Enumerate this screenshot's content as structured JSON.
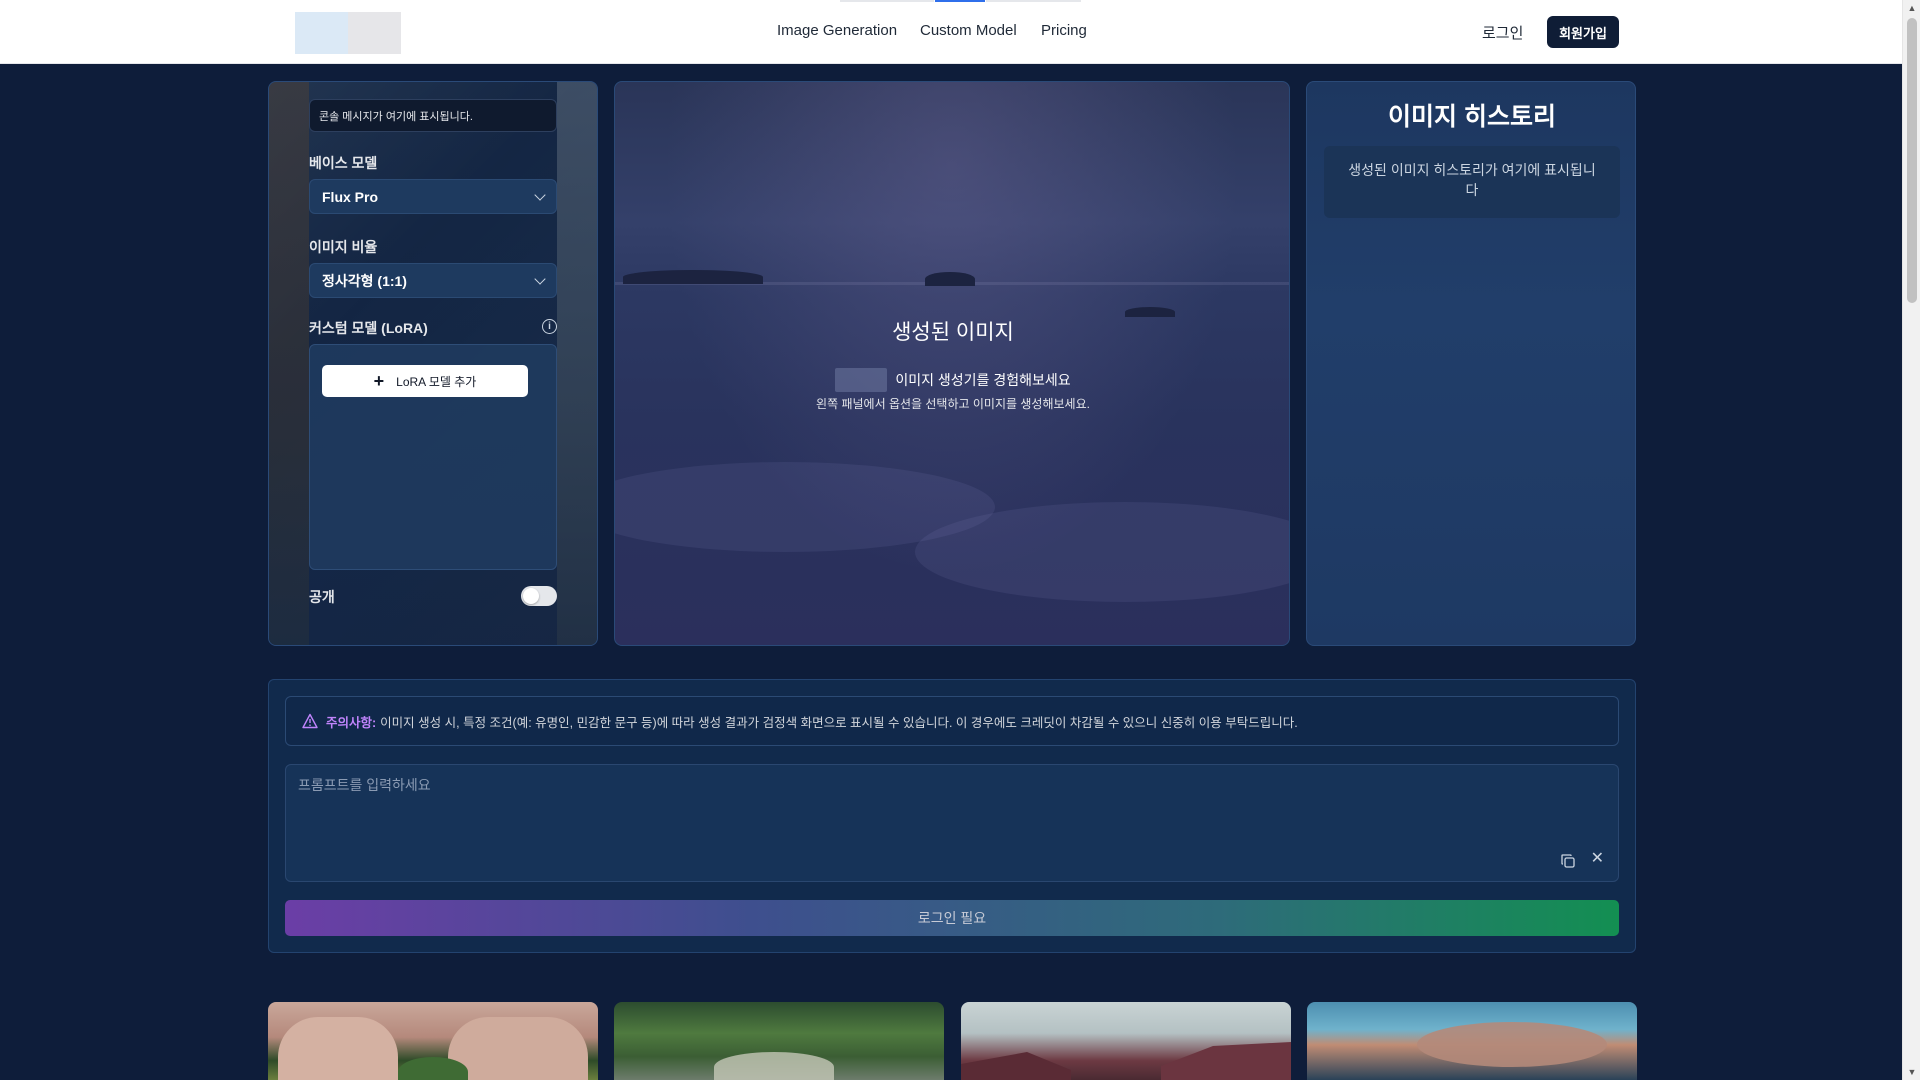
{
  "header": {
    "nav": [
      {
        "label": "Image Generation"
      },
      {
        "label": "Custom Model"
      },
      {
        "label": "Pricing"
      }
    ],
    "login_label": "로그인",
    "signup_label": "회원가입"
  },
  "left_panel": {
    "console_message": "콘솔 메시지가 여기에 표시됩니다.",
    "base_model_label": "베이스 모델",
    "base_model_value": "Flux Pro",
    "aspect_label": "이미지 비율",
    "aspect_value": "정사각형 (1:1)",
    "lora_label": "커스텀 모델 (LoRA)",
    "lora_add_label": "LoRA 모델 추가",
    "public_label": "공개",
    "public_enabled": false
  },
  "center_panel": {
    "title": "생성된 이미지",
    "subtitle": "이미지 생성기를 경험해보세요",
    "hint": "왼쪽 패널에서 옵션을 선택하고 이미지를 생성해보세요."
  },
  "right_panel": {
    "title": "이미지 히스토리",
    "empty_message": "생성된 이미지 히스토리가 여기에 표시됩니다"
  },
  "prompt_panel": {
    "notice_label": "주의사항:",
    "notice_text": "이미지 생성 시, 특정 조건(예: 유명인, 민감한 문구 등)에 따라 생성 결과가 검정색 화면으로 표시될 수 있습니다. 이 경우에도 크레딧이 차감될 수 있으니 신중히 이용 부탁드립니다.",
    "prompt_placeholder": "프롬프트를 입력하세요",
    "submit_label": "로그인 필요"
  },
  "colors": {
    "page_bg": "#0e1d3a",
    "notice_accent": "#c084fc",
    "button_gradient_start": "#6b3ea6",
    "button_gradient_end": "#138f52"
  }
}
